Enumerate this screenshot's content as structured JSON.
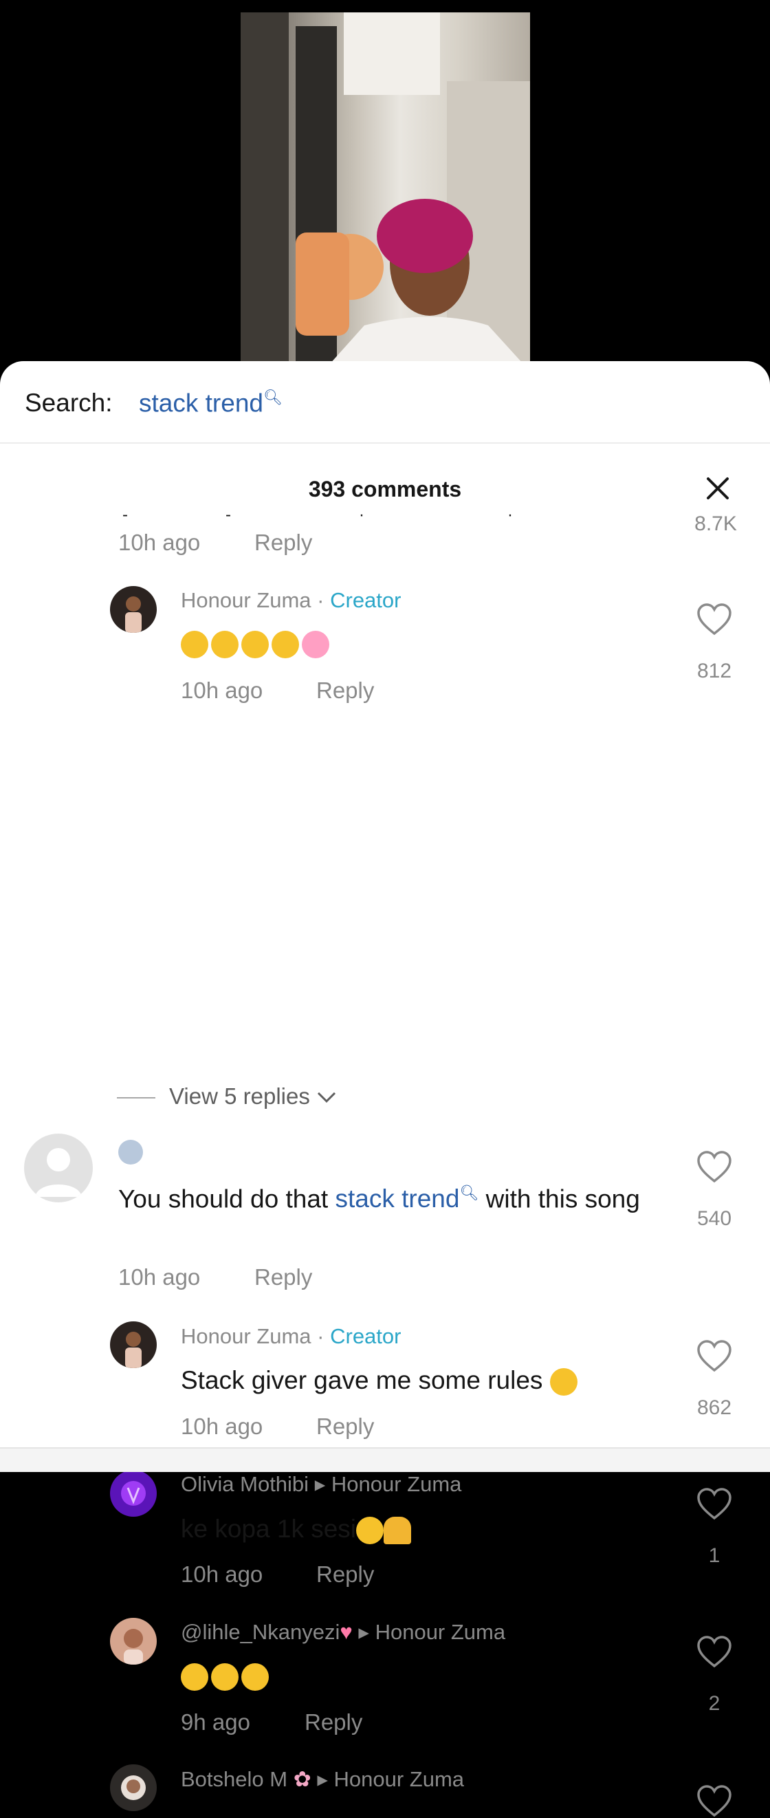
{
  "search": {
    "label": "Search:",
    "term": "stack trend",
    "icon": "search-icon"
  },
  "comments_header": {
    "count_label": "393 comments",
    "close_icon": "close-icon"
  },
  "top_comment": {
    "time": "10h ago",
    "reply": "Reply",
    "likes": "8.7K"
  },
  "comments": [
    {
      "name": "Honour Zuma",
      "tag": "Creator",
      "time": "10h ago",
      "reply": "Reply",
      "likes": "812"
    },
    {
      "name": "",
      "text_before": "You should do that ",
      "highlight": "stack trend",
      "text_after": " with this song",
      "time": "10h ago",
      "reply": "Reply",
      "likes": "540"
    },
    {
      "name": "Honour Zuma",
      "tag": "Creator",
      "text": "Stack giver gave me some rules",
      "time": "10h ago",
      "reply": "Reply",
      "likes": "862"
    },
    {
      "name": "Olivia Mothibi",
      "reply_to": "Honour Zuma",
      "text": "ke kopa 1k sesi",
      "time": "10h ago",
      "reply": "Reply",
      "likes": "1"
    },
    {
      "name": "@lihle_Nkanyezi",
      "reply_to": "Honour Zuma",
      "time": "9h ago",
      "reply": "Reply",
      "likes": "2"
    },
    {
      "name": "Botshelo M",
      "reply_to": "Honour Zuma"
    }
  ],
  "view_replies": "View 5 replies",
  "separators": {
    "dot": "·",
    "arrow": "▸"
  },
  "colors": {
    "link": "#2b5fa8",
    "creator": "#2aa6c8",
    "muted": "#8a8a8a",
    "text": "#161616"
  }
}
